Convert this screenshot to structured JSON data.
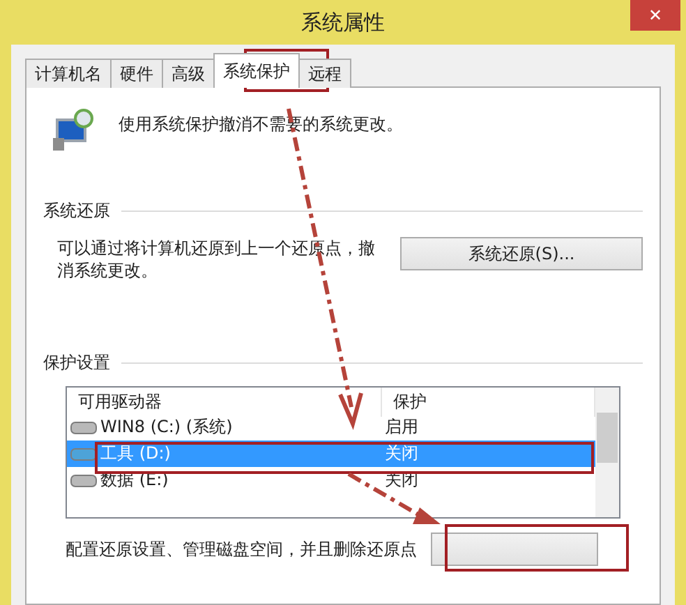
{
  "window": {
    "title": "系统属性",
    "close_glyph": "✕"
  },
  "tabs": [
    {
      "label": "计算机名",
      "selected": false
    },
    {
      "label": "硬件",
      "selected": false
    },
    {
      "label": "高级",
      "selected": false
    },
    {
      "label": "系统保护",
      "selected": true
    },
    {
      "label": "远程",
      "selected": false
    }
  ],
  "intro": "使用系统保护撤消不需要的系统更改。",
  "restore": {
    "title": "系统还原",
    "text": "可以通过将计算机还原到上一个还原点，撤消系统更改。",
    "button": "系统还原(S)..."
  },
  "protection": {
    "title": "保护设置",
    "columns": [
      "可用驱动器",
      "保护"
    ],
    "drives": [
      {
        "name": "WIN8 (C:) (系统)",
        "status": "启用",
        "selected": false
      },
      {
        "name": "工具 (D:)",
        "status": "关闭",
        "selected": true
      },
      {
        "name": "数据 (E:)",
        "status": "关闭",
        "selected": false
      }
    ],
    "config_text": "配置还原设置、管理磁盘空间，并且删除还原点"
  }
}
